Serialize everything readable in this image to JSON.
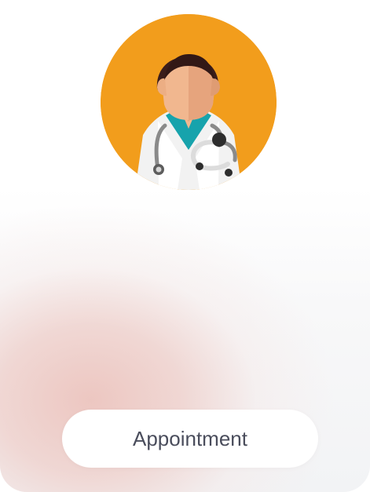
{
  "profile": {
    "avatar_icon": "doctor-avatar-icon",
    "avatar_background_color": "#f29d1c"
  },
  "actions": {
    "appointment_label": "Appointment"
  },
  "colors": {
    "accent_orange": "#f29d1c",
    "scrub_teal": "#1aa0a9",
    "button_text": "#4a4d5c"
  }
}
